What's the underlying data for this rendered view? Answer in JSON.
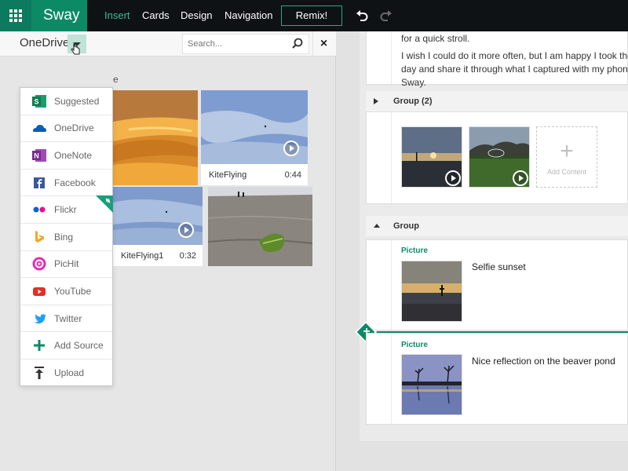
{
  "app": {
    "brand": "Sway",
    "tabs": [
      {
        "label": "Insert",
        "active": true
      },
      {
        "label": "Cards",
        "active": false
      },
      {
        "label": "Design",
        "active": false
      },
      {
        "label": "Navigation",
        "active": false
      }
    ],
    "remix_label": "Remix!",
    "accent_color": "#0c8a66"
  },
  "insert_pane": {
    "source_title": "OneDrive",
    "search_placeholder": "Search...",
    "close_label": "×",
    "partial_text": "e",
    "menu": [
      {
        "label": "Suggested",
        "icon": "suggested-icon"
      },
      {
        "label": "OneDrive",
        "icon": "onedrive-icon"
      },
      {
        "label": "OneNote",
        "icon": "onenote-icon"
      },
      {
        "label": "Facebook",
        "icon": "facebook-icon"
      },
      {
        "label": "Flickr",
        "icon": "flickr-icon"
      },
      {
        "label": "Bing",
        "icon": "bing-icon"
      },
      {
        "label": "PicHit",
        "icon": "pichit-icon"
      },
      {
        "label": "YouTube",
        "icon": "youtube-icon"
      },
      {
        "label": "Twitter",
        "icon": "twitter-icon"
      },
      {
        "label": "Add Source",
        "icon": "add-source-icon"
      },
      {
        "label": "Upload",
        "icon": "upload-icon"
      }
    ],
    "items": [
      {
        "name": "KiteFlying",
        "duration": "0:44"
      },
      {
        "name": "KiteFlying1",
        "duration": "0:32"
      }
    ]
  },
  "storyline": {
    "text_lines_top": [
      "for a quick stroll.",
      "I wish I could do it more often, but I am happy I took the tim",
      "day and share it through what I captured with my phone and",
      "Sway."
    ],
    "group2_label": "Group (2)",
    "add_content_label": "Add Content",
    "group_label": "Group",
    "cards": [
      {
        "type_label": "Picture",
        "title": "Selfie sunset"
      },
      {
        "type_label": "Picture",
        "title": "Nice reflection on the beaver pond"
      }
    ]
  }
}
